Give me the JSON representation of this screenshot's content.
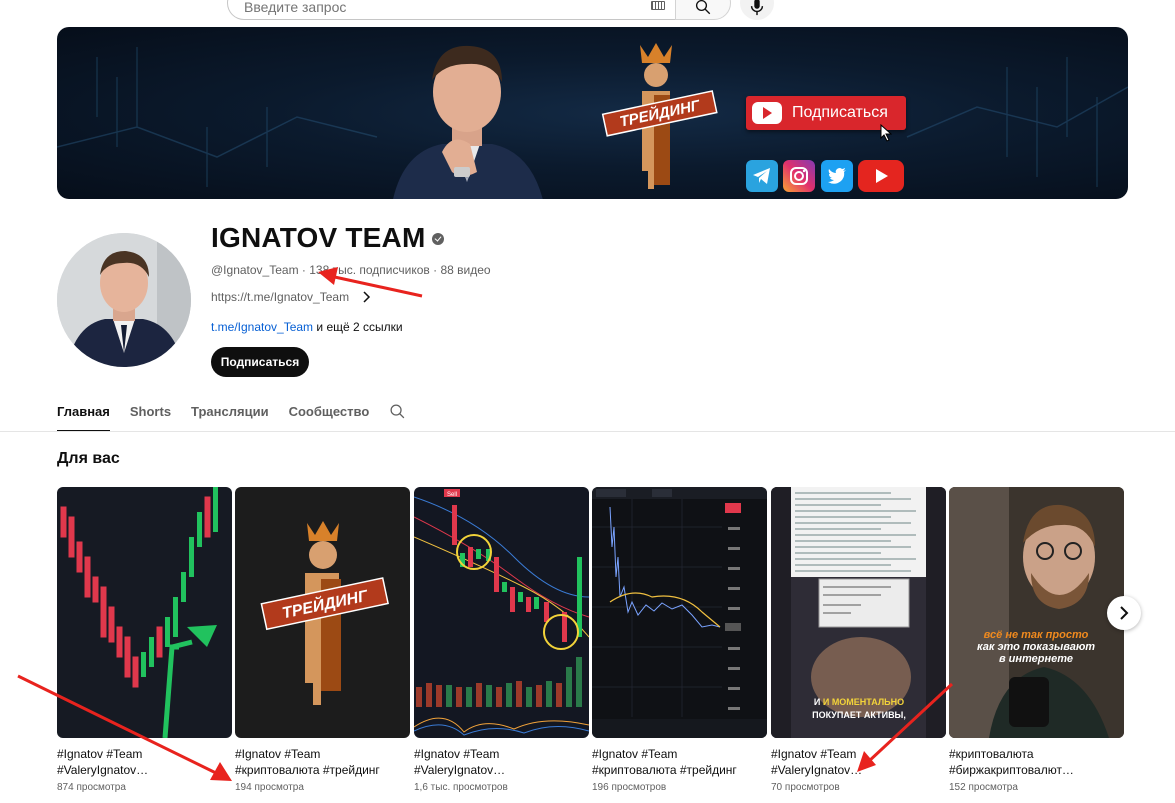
{
  "search": {
    "placeholder": "Введите запрос"
  },
  "banner": {
    "logo_text": "ТРЕЙДИНГ",
    "subscribe_label": "Подписаться",
    "social_icons": [
      "telegram-icon",
      "instagram-icon",
      "twitter-icon",
      "youtube-icon"
    ]
  },
  "channel": {
    "title": "IGNATOV TEAM",
    "handle": "@Ignatov_Team",
    "subscribers": "138 тыс. подписчиков",
    "videos": "88 видео",
    "sep": "·",
    "description_link": "https://t.me/Ignatov_Team",
    "link_text": "t.me/Ignatov_Team",
    "more_links": "и ещё 2 ссылки",
    "subscribe_label": "Подписаться"
  },
  "tabs": [
    {
      "label": "Главная",
      "active": true
    },
    {
      "label": "Shorts"
    },
    {
      "label": "Трансляции"
    },
    {
      "label": "Сообщество"
    }
  ],
  "section_title": "Для вас",
  "shorts": [
    {
      "title": "#Ignatov #Team #ValeryIgnatov…",
      "views": "874 просмотра"
    },
    {
      "title": "#Ignatov #Team #криптовалюта #трейдинг",
      "views": "194 просмотра",
      "logo_text": "ТРЕЙДИНГ"
    },
    {
      "title": "#Ignatov #Team #ValeryIgnatov…",
      "views": "1,6 тыс. просмотров",
      "badge": "Sell"
    },
    {
      "title": "#Ignatov #Team #криптовалюта #трейдинг",
      "views": "196 просмотров"
    },
    {
      "title": "#Ignatov #Team #ValeryIgnatov…",
      "views": "70 просмотров",
      "caption_1": "И МОМЕНТАЛЬНО",
      "caption_2": "ПОКУПАЕТ АКТИВЫ,"
    },
    {
      "title": "#криптовалюта #биржакриптовалют…",
      "views": "152 просмотра",
      "caption_1": "всё не так просто",
      "caption_2": "как это показывают",
      "caption_3": "в интернете"
    }
  ],
  "colors": {
    "accent_red": "#e8231e",
    "yt_red": "#d9262c",
    "green": "#21c25e"
  }
}
